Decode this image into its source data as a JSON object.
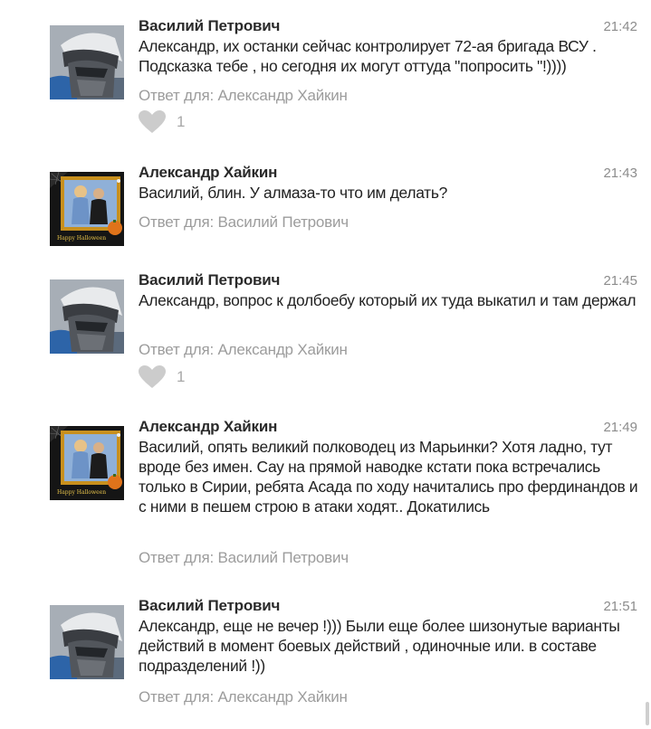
{
  "comments": [
    {
      "author": "Василий Петрович",
      "time": "21:42",
      "text": "Александр, их останки  сейчас контролирует 72-ая бригада ВСУ . Подсказка тебе , но сегодня их могут оттуда \"попросить \"!))))",
      "reply_to": "Ответ для: Александр Хайкин",
      "likes": "1",
      "avatar": "soldier-avatar"
    },
    {
      "author": "Александр Хайкин",
      "time": "21:43",
      "text": "Василий, блин. У алмаза-то что им делать?",
      "reply_to": "Ответ для: Василий Петрович",
      "avatar": "halloween-couple-avatar",
      "avatar_caption": "Happy Halloween"
    },
    {
      "author": "Василий Петрович",
      "time": "21:45",
      "text": "Александр, вопрос к долбоебу который их туда выкатил и там держал",
      "reply_to": "Ответ для: Александр Хайкин",
      "likes": "1",
      "avatar": "soldier-avatar"
    },
    {
      "author": "Александр Хайкин",
      "time": "21:49",
      "text": "Василий, опять великий полководец из Марьинки? Хотя ладно, тут вроде без имен. Сау на прямой наводке кстати пока встречались только в Сирии, ребята Асада по ходу начитались про фердинандов и с ними в пешем строю в атаки ходят.. Докатились",
      "reply_to": "Ответ для: Василий Петрович",
      "avatar": "halloween-couple-avatar",
      "avatar_caption": "Happy Halloween"
    },
    {
      "author": "Василий Петрович",
      "time": "21:51",
      "text": "Александр, еще не вечер !))) Были еще более шизонутые варианты действий в момент боевых действий , одиночные или. в составе подразделений !))",
      "reply_to": "Ответ для: Александр Хайкин",
      "avatar": "soldier-avatar"
    }
  ],
  "colors": {
    "author": "#2a2a2a",
    "text": "#222222",
    "meta": "#9c9c9c",
    "heart": "#cccccc"
  }
}
